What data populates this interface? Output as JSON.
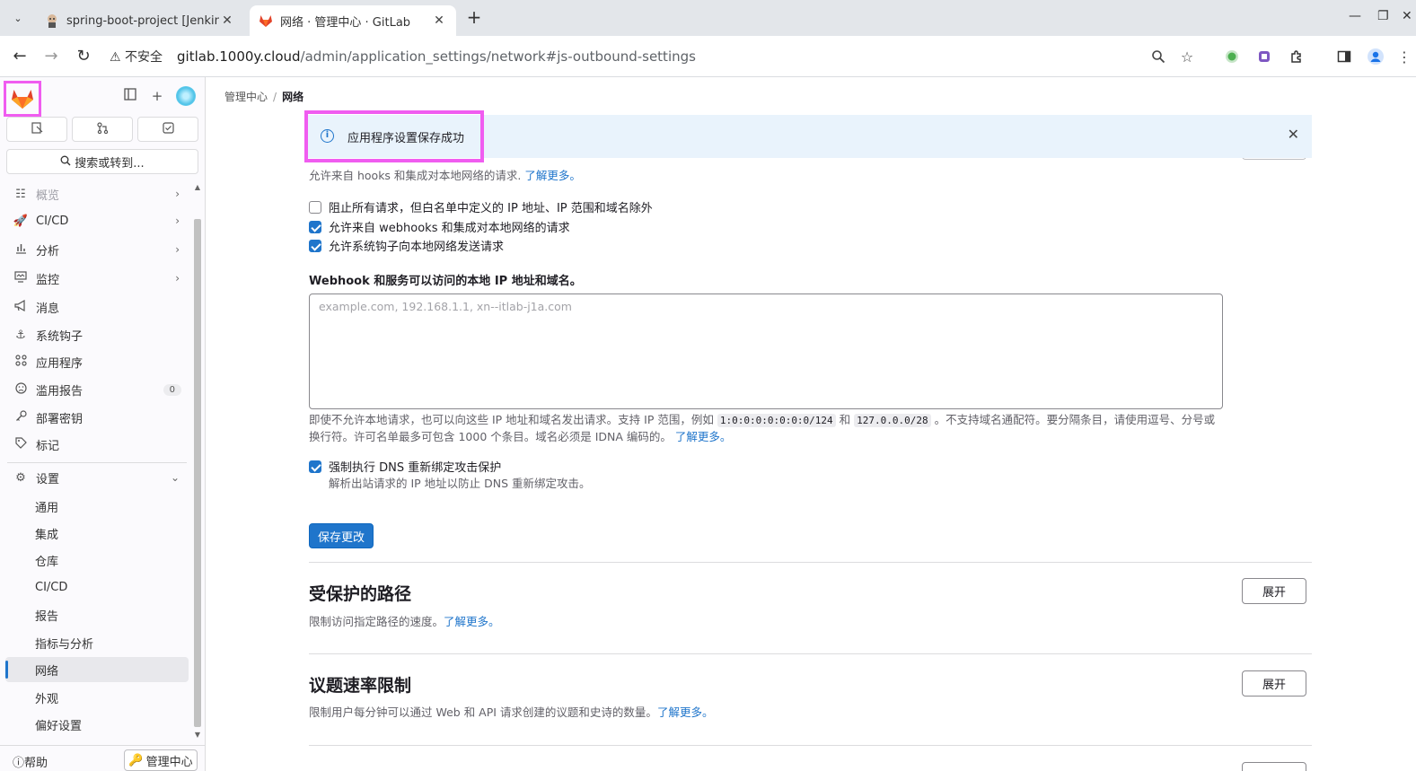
{
  "browser": {
    "tabs": [
      {
        "title": "spring-boot-project [Jenkins]",
        "active": false
      },
      {
        "title": "网络 · 管理中心 · GitLab",
        "active": true
      }
    ],
    "url_insecure_label": "不安全",
    "url_host": "gitlab.1000y.cloud",
    "url_path": "/admin/application_settings/network#js-outbound-settings"
  },
  "sidebar": {
    "search_label": "搜索或转到...",
    "items": [
      {
        "label": "概览",
        "icon": "overview-icon",
        "chevron": true
      },
      {
        "label": "CI/CD",
        "icon": "rocket-icon",
        "chevron": true
      },
      {
        "label": "分析",
        "icon": "chart-icon",
        "chevron": true
      },
      {
        "label": "监控",
        "icon": "monitor-icon",
        "chevron": true
      },
      {
        "label": "消息",
        "icon": "bullhorn-icon"
      },
      {
        "label": "系统钩子",
        "icon": "anchor-icon"
      },
      {
        "label": "应用程序",
        "icon": "apps-icon"
      },
      {
        "label": "滥用报告",
        "icon": "abuse-icon",
        "badge": "0"
      },
      {
        "label": "部署密钥",
        "icon": "key-icon"
      },
      {
        "label": "标记",
        "icon": "label-icon"
      },
      {
        "label": "设置",
        "icon": "settings-icon",
        "expanded": true
      }
    ],
    "settings_items": [
      "通用",
      "集成",
      "仓库",
      "CI/CD",
      "报告",
      "指标与分析",
      "网络",
      "外观",
      "偏好设置"
    ],
    "active_item": "网络",
    "help_label": "帮助",
    "admin_label": "管理中心"
  },
  "breadcrumb": {
    "parent": "管理中心",
    "current": "网络"
  },
  "alert": {
    "message": "应用程序设置保存成功"
  },
  "outbound": {
    "description": "允许来自 hooks 和集成对本地网络的请求.",
    "learn_more": "了解更多。",
    "checkboxes": [
      {
        "label": "阻止所有请求，但白名单中定义的 IP 地址、IP 范围和域名除外",
        "checked": false
      },
      {
        "label": "允许来自 webhooks 和集成对本地网络的请求",
        "checked": true
      },
      {
        "label": "允许系统钩子向本地网络发送请求",
        "checked": true
      }
    ],
    "allowlist_label": "Webhook 和服务可以访问的本地 IP 地址和域名。",
    "allowlist_placeholder": "example.com, 192.168.1.1, xn--itlab-j1a.com",
    "help_part1": "即使不允许本地请求，也可以向这些 IP 地址和域名发出请求。支持 IP 范围，例如",
    "code1": "1:0:0:0:0:0:0:0/124",
    "help_and": "和",
    "code2": "127.0.0.0/28",
    "help_part2": "。不支持域名通配符。要分隔条目，请使用逗号、分号或换行符。许可名单最多可包含 1000 个条目。域名必须是 IDNA 编码的。",
    "help_learn_more": "了解更多。",
    "dns_label": "强制执行 DNS 重新绑定攻击保护",
    "dns_checked": true,
    "dns_help": "解析出站请求的 IP 地址以防止 DNS 重新绑定攻击。",
    "save_label": "保存更改"
  },
  "sections": [
    {
      "title": "受保护的路径",
      "description": "限制访问指定路径的速度。",
      "learn_more": "了解更多。",
      "button": "展开"
    },
    {
      "title": "议题速率限制",
      "description": "限制用户每分钟可以通过 Web 和 API 请求创建的议题和史诗的数量。",
      "learn_more": "了解更多。",
      "button": "展开"
    }
  ],
  "colors": {
    "accent": "#1f75cb",
    "highlight": "#f05cf0",
    "alert_bg": "#e9f3fc"
  }
}
